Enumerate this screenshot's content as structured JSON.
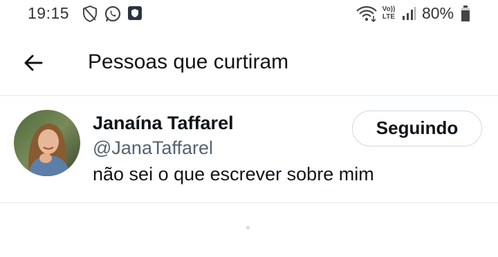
{
  "status_bar": {
    "time": "19:15",
    "left_icons": [
      "shield-icon",
      "whatsapp-icon",
      "app-notification-icon"
    ],
    "right_icons": [
      "wifi-icon",
      "volte-icon",
      "signal-icon",
      "battery-icon"
    ],
    "volte_label": "Vo)) LTE",
    "battery": "80%"
  },
  "header": {
    "title": "Pessoas que curtiram",
    "back_icon": "arrow-left-icon"
  },
  "users": [
    {
      "name": "Janaína Taffarel",
      "handle": "@JanaTaffarel",
      "bio": "não sei o que escrever sobre mim",
      "follow_label": "Seguindo"
    }
  ],
  "colors": {
    "text_primary": "#0f1419",
    "text_secondary": "#536471",
    "divider": "#e6e9eb",
    "button_border": "#cfd9de"
  }
}
